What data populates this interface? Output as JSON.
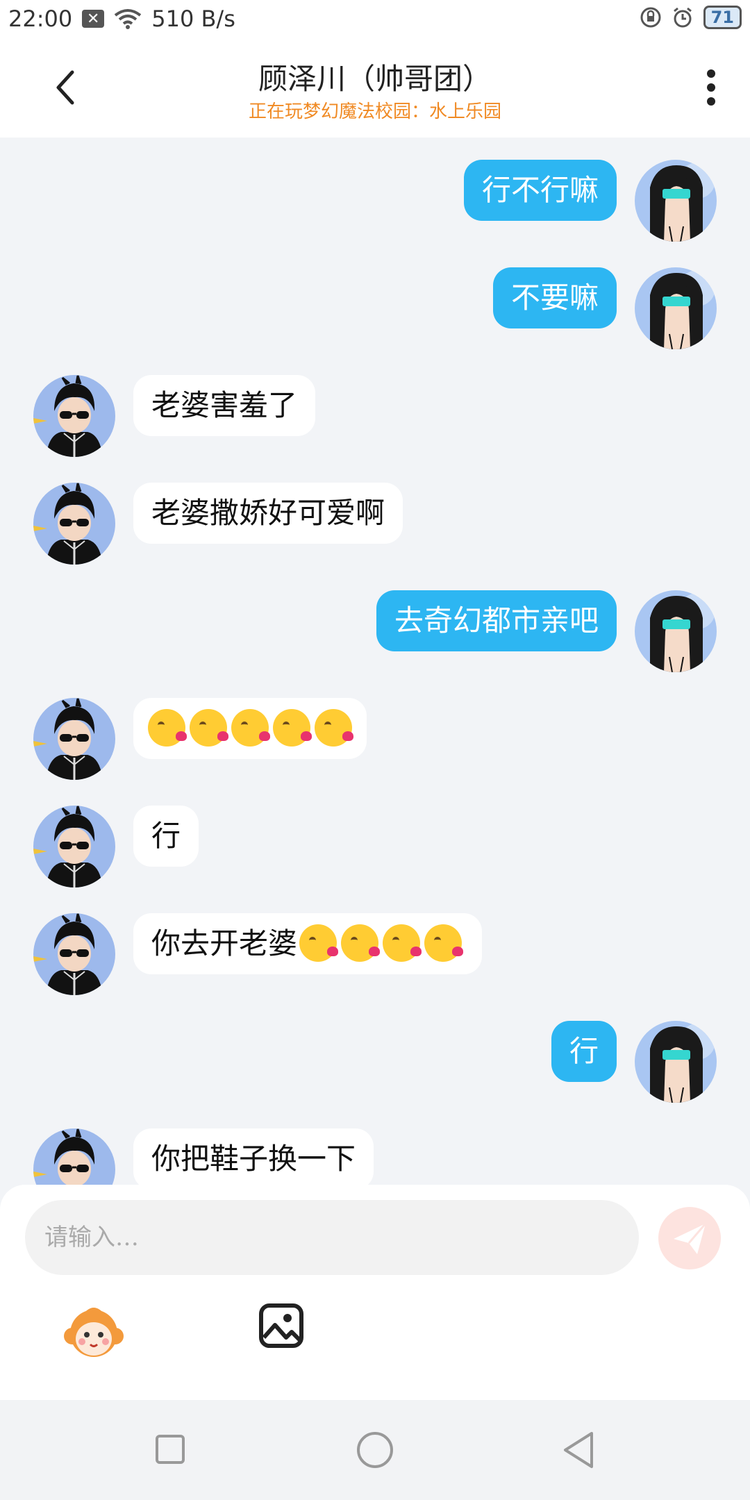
{
  "status_bar": {
    "time": "22:00",
    "speed": "510 B/s",
    "battery": "71"
  },
  "header": {
    "title": "顾泽川（帅哥团）",
    "subtitle": "正在玩梦幻魔法校园：水上乐园"
  },
  "messages": [
    {
      "side": "right",
      "text": "行不行嘛"
    },
    {
      "side": "right",
      "text": "不要嘛"
    },
    {
      "side": "left",
      "text": "老婆害羞了"
    },
    {
      "side": "left",
      "text": "老婆撒娇好可爱啊"
    },
    {
      "side": "right",
      "text": "去奇幻都市亲吧"
    },
    {
      "side": "left",
      "text": "",
      "emoji_count": 5
    },
    {
      "side": "left",
      "text": "行"
    },
    {
      "side": "left",
      "text": "你去开老婆",
      "emoji_count": 4
    },
    {
      "side": "right",
      "text": "行"
    },
    {
      "side": "left",
      "text": "你把鞋子换一下"
    }
  ],
  "input": {
    "placeholder": "请输入…"
  },
  "icons": {
    "back": "chevron-left-icon",
    "more": "more-vertical-icon",
    "send": "send-icon",
    "emoji": "monkey-emoji-icon",
    "image": "image-icon",
    "emoji_in_message": "kissing-face-emoji"
  },
  "colors": {
    "accent": "#2db6f2",
    "subtitle": "#f08a24",
    "background": "#f2f4f7",
    "send_disabled": "#fde3df"
  }
}
